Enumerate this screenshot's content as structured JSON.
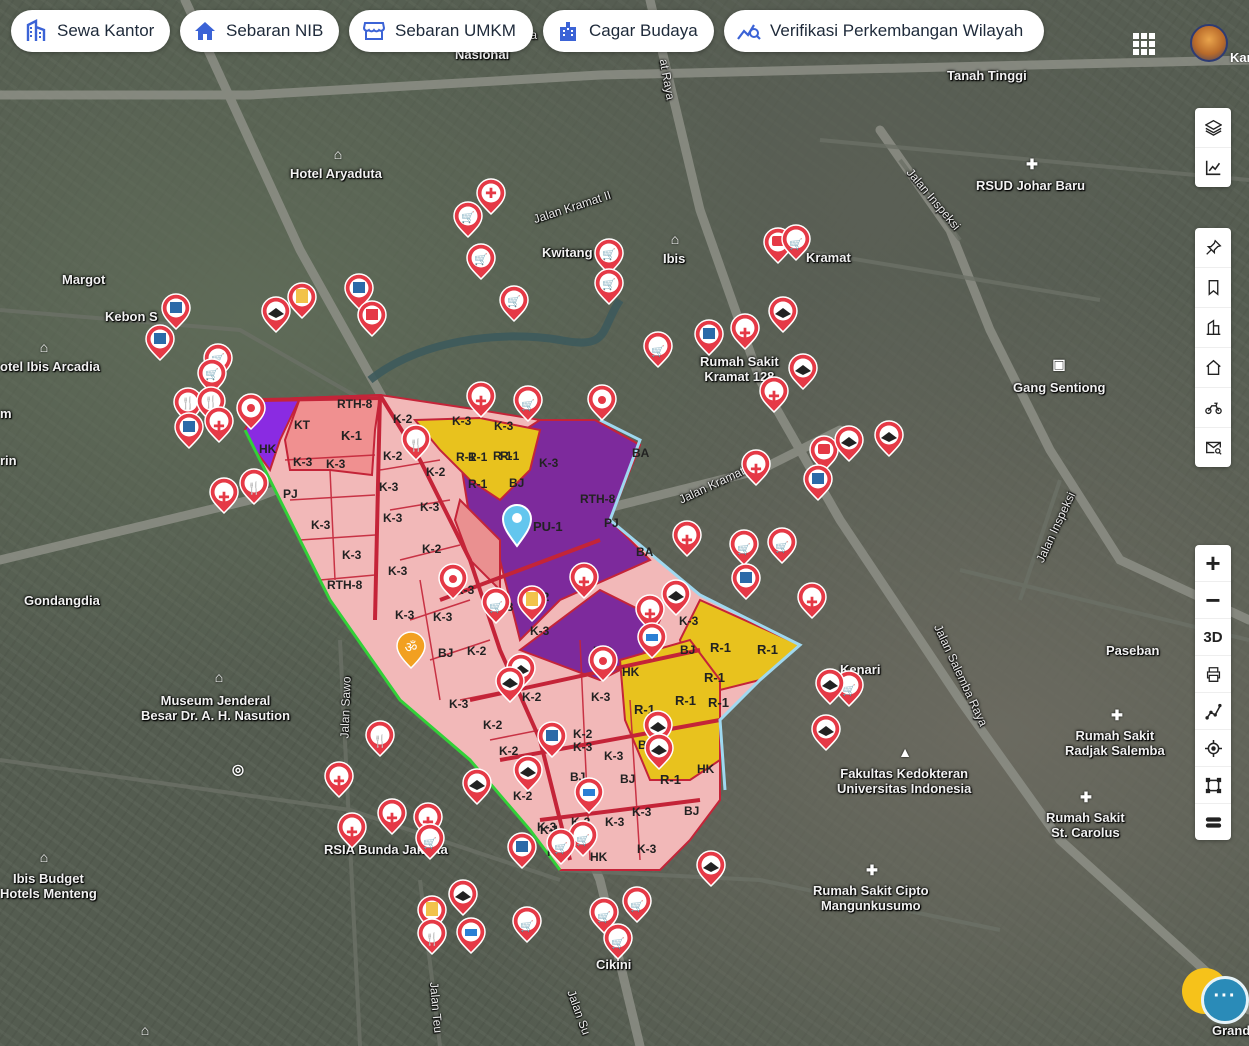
{
  "nav": {
    "chips": [
      {
        "label": "Sewa Kantor",
        "icon": "building-icon"
      },
      {
        "label": "Sebaran NIB",
        "icon": "home-icon"
      },
      {
        "label": "Sebaran UMKM",
        "icon": "store-icon"
      },
      {
        "label": "Cagar Budaya",
        "icon": "heritage-building-icon"
      },
      {
        "label": "Verifikasi Perkembangan Wilayah",
        "icon": "chart-search-icon"
      }
    ],
    "user_name": "Kan"
  },
  "tools": {
    "top": [
      "layers-icon",
      "chart-line-icon"
    ],
    "middle": [
      "pin-icon",
      "bookmark-icon",
      "building-outline-icon",
      "house-icon",
      "motorbike-icon",
      "mail-search-icon"
    ],
    "zoom_in": "+",
    "zoom_out": "−",
    "three_d": "3D",
    "bottom": [
      "printer-icon",
      "measure-line-icon",
      "locate-icon",
      "polygon-icon",
      "stack-icon"
    ]
  },
  "chat": {
    "dots": "···"
  },
  "places": [
    {
      "name": "Hotel Aryaduta"
    },
    {
      "name": "Margot"
    },
    {
      "name": "Kebon S"
    },
    {
      "name": "otel Ibis Arcadia"
    },
    {
      "name": "Gondangdia"
    },
    {
      "name": "Museum Jenderal\nBesar Dr. A. H. Nasution"
    },
    {
      "name": "RSIA Bunda Jakarta"
    },
    {
      "name": "Ibis Budget\nHotels Menteng"
    },
    {
      "name": "Kwitang"
    },
    {
      "name": "Ibis"
    },
    {
      "name": "Kramat"
    },
    {
      "name": "Rumah Sakit\nKramat 128"
    },
    {
      "name": "Gang Sentiong"
    },
    {
      "name": "RSUD Johar Baru"
    },
    {
      "name": "Tanah Tinggi"
    },
    {
      "name": "Kenari"
    },
    {
      "name": "Paseban"
    },
    {
      "name": "Fakultas Kedokteran\nUniversitas Indonesia"
    },
    {
      "name": "Rumah Sakit\nRadjak Salemba"
    },
    {
      "name": "Rumah Sakit\nSt. Carolus"
    },
    {
      "name": "Rumah Sakit Cipto\nMangunkusumo"
    },
    {
      "name": "Cikini"
    },
    {
      "name": "Nasional"
    },
    {
      "name": "Grand"
    },
    {
      "name": "m"
    },
    {
      "name": "rin"
    }
  ],
  "roads": [
    {
      "name": "Jalan Kramat II"
    },
    {
      "name": "Jalan Kramat II"
    },
    {
      "name": "Jalan Inspeksi"
    },
    {
      "name": "Jalan Inspeksi"
    },
    {
      "name": "Jalan Salemba Raya"
    },
    {
      "name": "Jalan Sawo"
    },
    {
      "name": "at Raya"
    },
    {
      "name": "Jalan Teu"
    },
    {
      "name": "Jalan Su"
    },
    {
      "name": "ta"
    }
  ],
  "zones": [
    "RTH-8",
    "K-2",
    "K-3",
    "K-1",
    "KT",
    "HK",
    "K-3",
    "K-3",
    "PJ",
    "K-3",
    "K-3",
    "K-3",
    "K-3",
    "K-3",
    "K-2",
    "K-3",
    "K-2",
    "K-3",
    "K-3",
    "R-1",
    "R-1",
    "R-1",
    "RTH-8",
    "PU-1",
    "K-3",
    "BA",
    "BA",
    "PJ",
    "RTH-8",
    "K-3",
    "K-3",
    "BJ",
    "K-2",
    "K-2",
    "K-2",
    "K-3",
    "HK",
    "K-3",
    "K-2",
    "K-3",
    "K-2",
    "K-3",
    "K-2",
    "BJ",
    "K-3",
    "R-1",
    "R-1",
    "R-1",
    "R-1",
    "R-1",
    "R-1",
    "R-1",
    "BJ",
    "BJ",
    "HK",
    "BJ",
    "K-3",
    "K-3",
    "BJ",
    "K-3",
    "HK",
    "K-3",
    "K-2",
    "K-1",
    "K-3",
    "K-3",
    "R-1",
    "R-1",
    "BJ",
    "K-3",
    "K-3",
    "K-2",
    "BI",
    "K-2"
  ]
}
